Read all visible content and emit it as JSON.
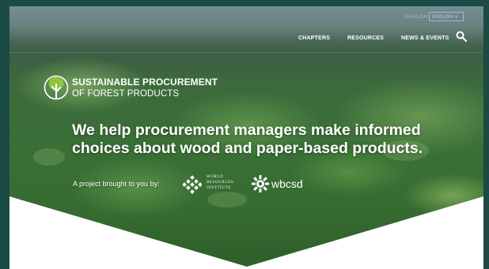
{
  "header": {
    "language_link": "ENGLISH",
    "language_select": "ENGLISH",
    "nav": [
      {
        "label": "CHAPTERS"
      },
      {
        "label": "RESOURCES"
      },
      {
        "label": "NEWS & EVENTS"
      }
    ]
  },
  "logo": {
    "line1": "SUSTAINABLE PROCUREMENT",
    "line2": "OF FOREST PRODUCTS"
  },
  "hero": {
    "headline_line1": "We help procurement managers make informed",
    "headline_line2": "choices about wood and paper-based products.",
    "byline": "A project brought to you by:"
  },
  "partners": {
    "wri": [
      "WORLD",
      "RESOURCES",
      "INSTITUTE"
    ],
    "wbcsd": "wbcsd"
  },
  "colors": {
    "outer_background": "#1c4a44",
    "logo_green": "#8cc63f",
    "panel_white": "#ffffff",
    "nav_text": "#ffffff"
  },
  "icons": {
    "search": "search-icon",
    "chevron": "chevron-down-icon",
    "logo": "tree-icon"
  }
}
